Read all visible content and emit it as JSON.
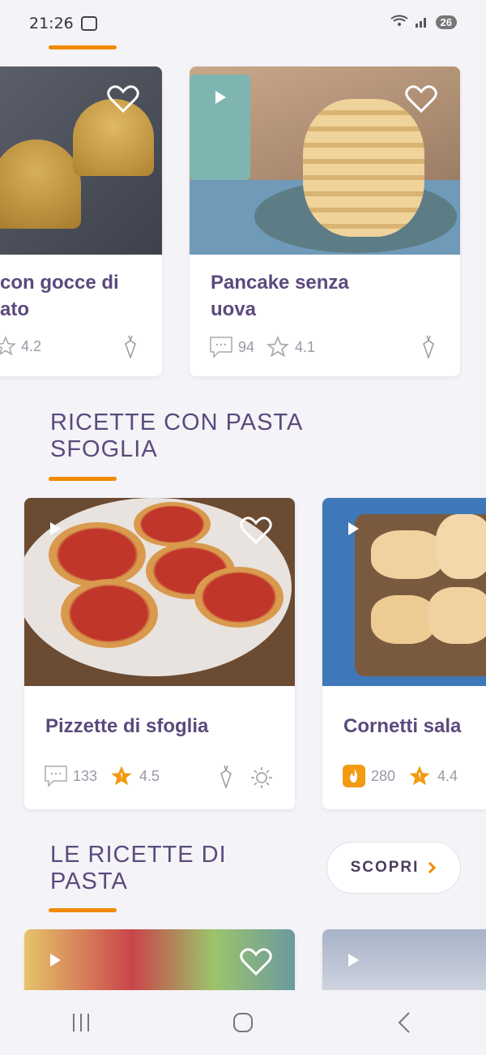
{
  "status": {
    "time": "21:26",
    "battery": "26"
  },
  "carousel1": [
    {
      "title_line1": "con gocce di",
      "title_line2": "ato",
      "rating": "4.2"
    },
    {
      "title_line1": "Pancake senza",
      "title_line2": "uova",
      "comments": "94",
      "rating": "4.1"
    }
  ],
  "section2": {
    "title_line1": "RICETTE CON PASTA",
    "title_line2": "SFOGLIA"
  },
  "carousel2": [
    {
      "title": "Pizzette di sfoglia",
      "comments": "133",
      "rating": "4.5"
    },
    {
      "title": "Cornetti sala",
      "count": "280",
      "rating": "4.4"
    }
  ],
  "section3": {
    "title_line1": "LE RICETTE DI",
    "title_line2": "PASTA",
    "cta": "SCOPRI"
  },
  "colors": {
    "accent": "#f18a00",
    "title": "#5b4a7d",
    "background": "#f4f3f7"
  }
}
